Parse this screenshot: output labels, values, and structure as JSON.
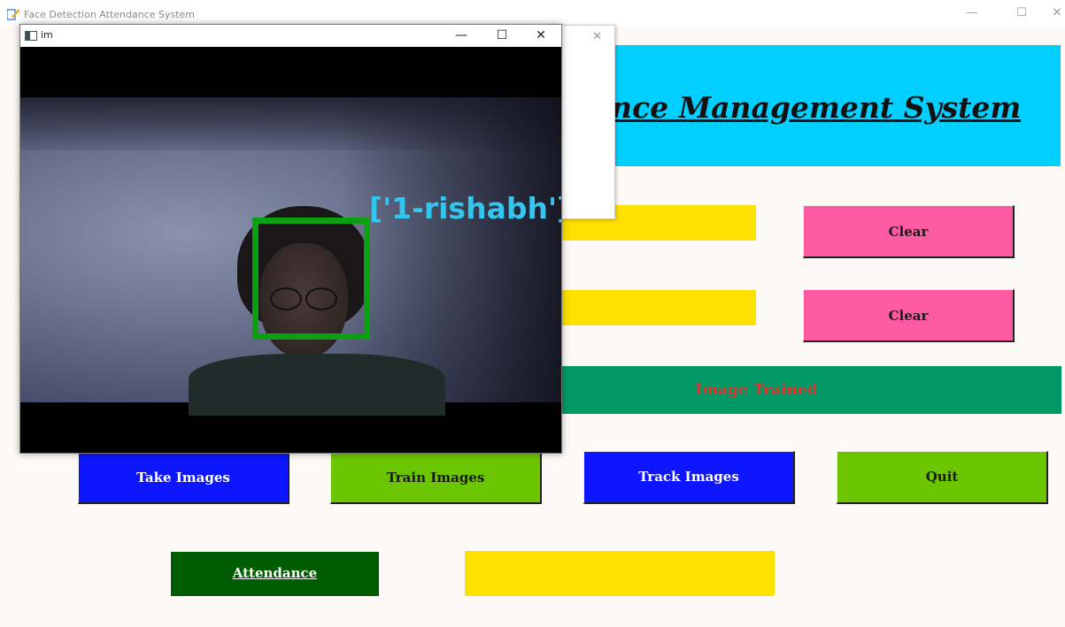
{
  "main_window": {
    "title": "Face Detection Attendance System",
    "controls": {
      "minimize": "—",
      "maximize": "☐",
      "close": "✕"
    }
  },
  "header": {
    "text": "nce Management System"
  },
  "buttons": {
    "clear_1": "Clear",
    "clear_2": "Clear",
    "take_images": "Take Images",
    "train_images": "Train Images",
    "track_images": "Track Images",
    "quit": "Quit",
    "attendance": "Attendance"
  },
  "status": {
    "message": "Image Trained"
  },
  "dialog": {
    "close": "✕"
  },
  "camera_window": {
    "title": "im",
    "controls": {
      "minimize": "—",
      "maximize": "☐",
      "close": "✕"
    },
    "detection_label": "['1-rishabh']"
  },
  "colors": {
    "header_bg": "#00cfff",
    "yellow": "#ffe100",
    "pink": "#ff5ba3",
    "blue": "#0d16ff",
    "lime": "#6bc600",
    "dark_green": "#005c00",
    "teal": "#009966",
    "status_text": "#e0302a",
    "face_box": "#0aa012",
    "detection_label": "#33c6ee"
  }
}
